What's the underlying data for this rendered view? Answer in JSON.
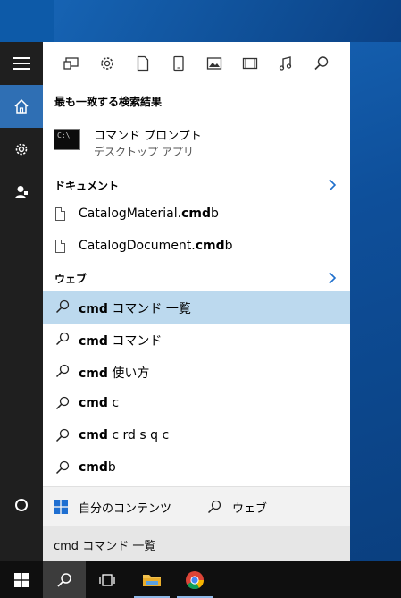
{
  "rail": {
    "items": [
      {
        "name": "hamburger-menu",
        "icon": "hamburger-icon"
      },
      {
        "name": "home",
        "icon": "home-icon"
      },
      {
        "name": "settings",
        "icon": "gear-icon"
      },
      {
        "name": "account",
        "icon": "person-icon"
      }
    ],
    "cortana_icon": "cortana-circle-icon"
  },
  "filters": [
    {
      "icon": "apps-icon"
    },
    {
      "icon": "settings-gear-icon"
    },
    {
      "icon": "document-icon"
    },
    {
      "icon": "tablet-icon"
    },
    {
      "icon": "photo-icon"
    },
    {
      "icon": "video-icon"
    },
    {
      "icon": "music-icon"
    },
    {
      "icon": "web-search-icon"
    }
  ],
  "best_match": {
    "section_title": "最も一致する検索結果",
    "title": "コマンド プロンプト",
    "subtitle": "デスクトップ アプリ",
    "icon_text": "C:\\_"
  },
  "documents": {
    "section_title": "ドキュメント",
    "items": [
      {
        "prefix": "CatalogMaterial.",
        "bold": "cmd",
        "suffix": "b"
      },
      {
        "prefix": "CatalogDocument.",
        "bold": "cmd",
        "suffix": "b"
      }
    ]
  },
  "web": {
    "section_title": "ウェブ",
    "suggestions": [
      {
        "bold": "cmd",
        "rest": " コマンド 一覧",
        "highlighted": true
      },
      {
        "bold": "cmd",
        "rest": " コマンド",
        "highlighted": false
      },
      {
        "bold": "cmd",
        "rest": " 使い方",
        "highlighted": false
      },
      {
        "bold": "cmd",
        "rest": " c",
        "highlighted": false
      },
      {
        "bold": "cmd",
        "rest": " c rd s q c",
        "highlighted": false
      },
      {
        "bold": "cmd",
        "rest": "b",
        "highlighted": false
      }
    ]
  },
  "bottom": {
    "my_content_label": "自分のコンテンツ",
    "web_label": "ウェブ"
  },
  "search_box": {
    "query": "cmd コマンド 一覧"
  },
  "colors": {
    "accent": "#2f6fb4",
    "highlight": "#bcd9ee",
    "link_chevron": "#1e6fcc"
  },
  "taskbar": {
    "items": [
      {
        "icon": "windows-start-icon"
      },
      {
        "icon": "search-icon",
        "active": true
      },
      {
        "icon": "task-view-icon"
      },
      {
        "icon": "file-explorer-icon"
      },
      {
        "icon": "chrome-icon"
      }
    ]
  }
}
